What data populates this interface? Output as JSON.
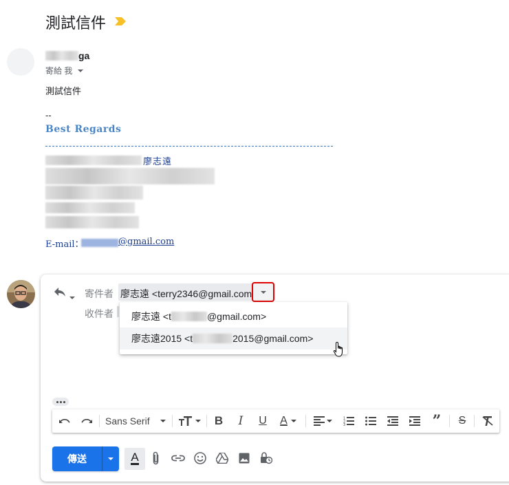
{
  "message": {
    "subject": "測試信件",
    "sender_visible_suffix": "ga",
    "to_line": "寄給 我",
    "body": "測試信件",
    "signature": {
      "dash": "--",
      "regards": "Best Regards",
      "name": "廖志遠",
      "email_label": "E-mail：",
      "email_domain": "@gmail.com"
    }
  },
  "compose": {
    "from_label": "寄件者",
    "from_value": "廖志遠 <terry2346@gmail.com>",
    "to_label": "收件者",
    "from_options": [
      {
        "prefix": "廖志遠 <t",
        "suffix": "@gmail.com>"
      },
      {
        "prefix": "廖志遠2015 <t",
        "suffix": "2015@gmail.com>"
      }
    ],
    "font_name": "Sans Serif",
    "send_label": "傳送"
  },
  "colors": {
    "accent_blue": "#1a73e8",
    "regards_blue": "#4a86c5",
    "highlight_red": "#e00000",
    "importance_marker": "#f6c026"
  },
  "icons": {
    "importance": "importance-marker-icon",
    "reply": "reply-icon",
    "dropdown": "chevron-down-icon",
    "undo": "undo-icon",
    "redo": "redo-icon",
    "font_size": "font-size-icon",
    "bold": "bold-icon",
    "italic": "italic-icon",
    "underline": "underline-icon",
    "text_color": "text-color-icon",
    "align": "align-icon",
    "numbered_list": "numbered-list-icon",
    "bulleted_list": "bulleted-list-icon",
    "indent_less": "indent-less-icon",
    "indent_more": "indent-more-icon",
    "quote": "quote-icon",
    "strikethrough": "strikethrough-icon",
    "clear_format": "clear-format-icon",
    "attach": "attach-icon",
    "link": "link-icon",
    "emoji": "emoji-icon",
    "drive": "drive-icon",
    "photo": "photo-icon",
    "confidential": "confidential-mode-icon"
  }
}
